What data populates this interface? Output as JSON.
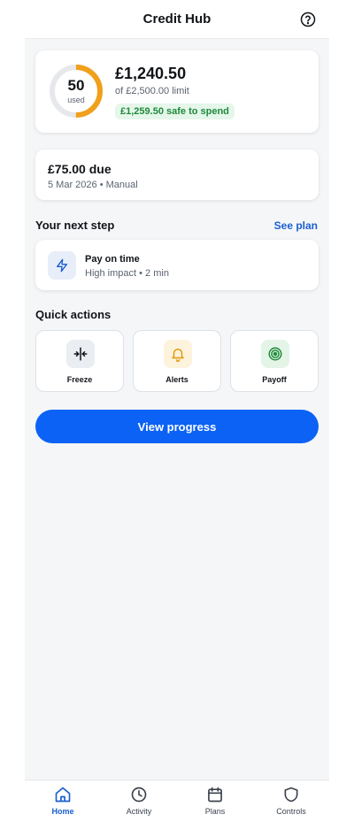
{
  "header": {
    "title": "Credit Hub",
    "help_icon": "help-circle-icon"
  },
  "balance": {
    "utilization": 50,
    "utilization_label": "used",
    "amount": "£1,240.50",
    "limit_text": "of £2,500.00 limit",
    "safe_to_spend": "£1,259.50 safe to spend",
    "gauge_color": "#f0a01a",
    "gauge_track_color": "#e6e8eb"
  },
  "due": {
    "amount": "£75.00 due",
    "meta": "5 Mar 2026 • Manual"
  },
  "next_step": {
    "title": "Your next step",
    "link": "See plan",
    "item_title": "Pay on time",
    "item_meta": "High impact • 2 min",
    "icon": "lightning-icon"
  },
  "quick_actions": {
    "title": "Quick actions",
    "items": [
      {
        "label": "Freeze",
        "icon": "freeze-icon",
        "bg": "#eaedf1",
        "color": "#111418"
      },
      {
        "label": "Alerts",
        "icon": "bell-icon",
        "bg": "#fdf3dd",
        "color": "#e09a0c"
      },
      {
        "label": "Payoff",
        "icon": "target-icon",
        "bg": "#e4f5e8",
        "color": "#1f8a3a"
      }
    ]
  },
  "primary_action": "View progress",
  "tabs": [
    {
      "label": "Home",
      "icon": "home-icon",
      "active": true
    },
    {
      "label": "Activity",
      "icon": "clock-icon",
      "active": false
    },
    {
      "label": "Plans",
      "icon": "calendar-icon",
      "active": false
    },
    {
      "label": "Controls",
      "icon": "shield-icon",
      "active": false
    }
  ],
  "colors": {
    "accent": "#0b62f5",
    "link": "#1a5fd0",
    "success": "#1f8a3a"
  }
}
